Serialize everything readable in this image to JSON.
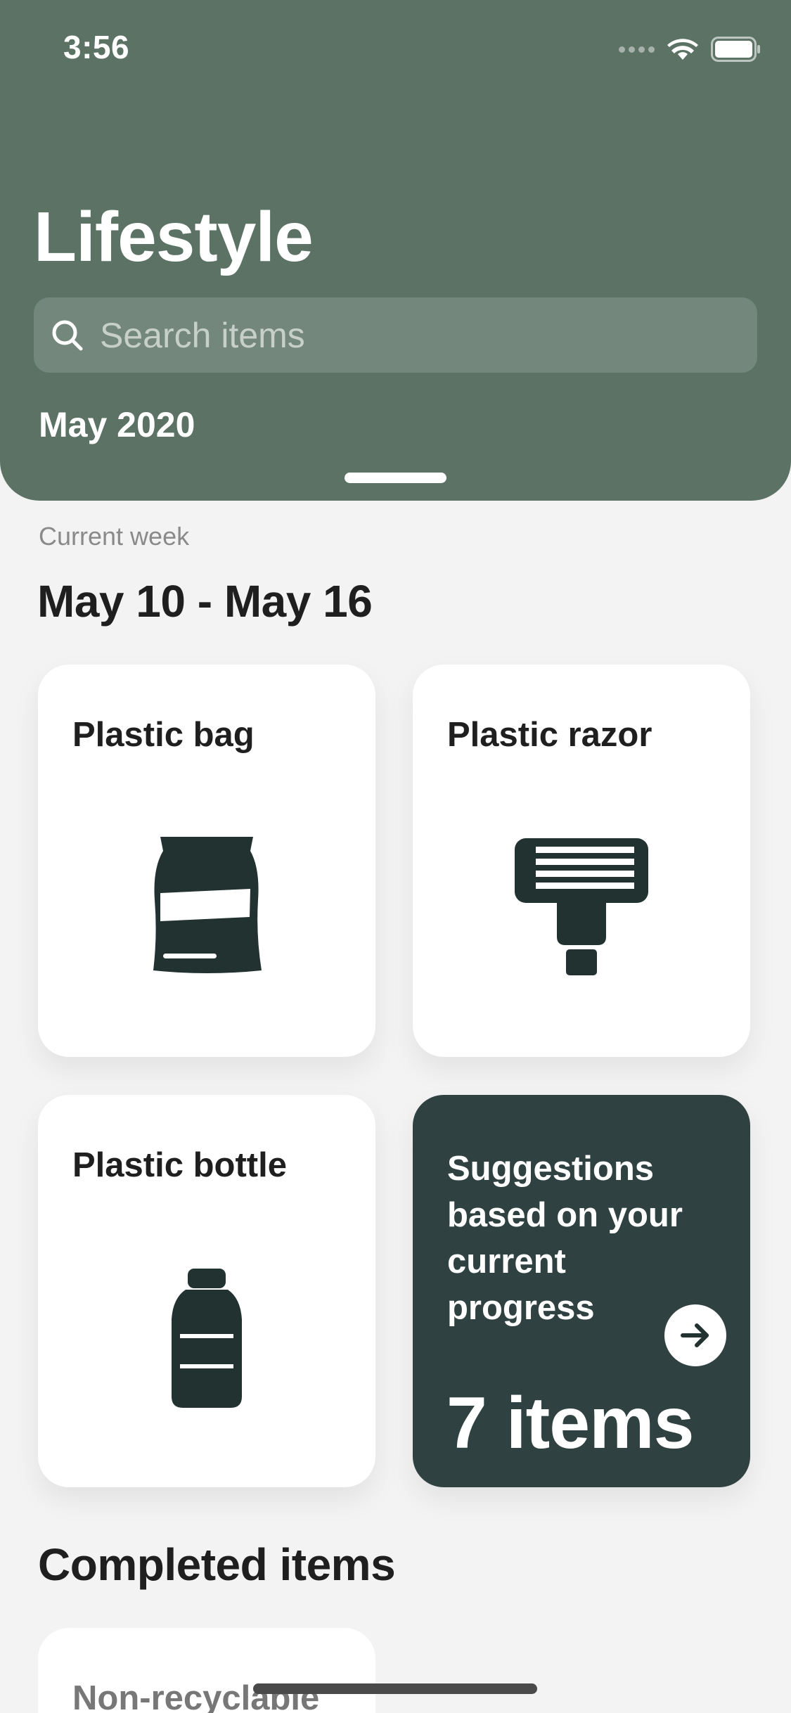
{
  "status": {
    "time": "3:56"
  },
  "header": {
    "title": "Lifestyle",
    "search_placeholder": "Search items",
    "month": "May 2020"
  },
  "week": {
    "label": "Current week",
    "range": "May 10 - May 16"
  },
  "cards": [
    {
      "title": "Plastic bag",
      "icon": "plastic-bag-icon"
    },
    {
      "title": "Plastic razor",
      "icon": "razor-icon"
    },
    {
      "title": "Plastic bottle",
      "icon": "bottle-icon"
    }
  ],
  "suggestions": {
    "text": "Suggestions based on your current progress",
    "count": "7 items",
    "icon": "arrow-right-icon"
  },
  "completed": {
    "title": "Completed items",
    "first_item": "Non-recyclable"
  },
  "colors": {
    "header": "#5b7265",
    "dark_card": "#2f4140",
    "icon_fill": "#223230",
    "background": "#f3f3f3"
  }
}
